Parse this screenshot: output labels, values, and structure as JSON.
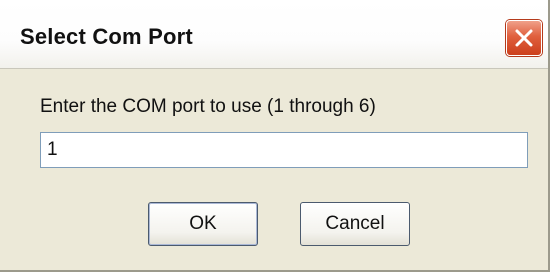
{
  "dialog": {
    "title": "Select Com Port",
    "prompt": "Enter the COM port to use (1 through 6)",
    "port_value": "1",
    "ok_label": "OK",
    "cancel_label": "Cancel"
  },
  "icons": {
    "close": "close-icon"
  },
  "colors": {
    "dialog_background": "#ece9d8",
    "close_button": "#d9522f"
  }
}
